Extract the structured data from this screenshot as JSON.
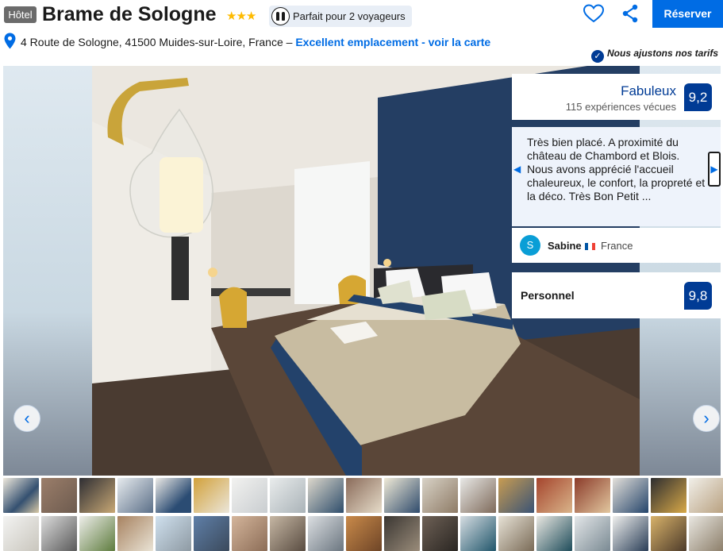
{
  "header": {
    "badge": "Hôtel",
    "hotel_name": "Brame de Sologne",
    "stars": "★★★",
    "travelers": "Parfait pour 2 voyageurs",
    "reserve_label": "Réserver",
    "address": "4 Route de Sologne, 41500 Muides-sur-Loire, France –",
    "location_link": "Excellent emplacement - voir la carte",
    "price_note": "Nous ajustons nos tarifs"
  },
  "icons": {
    "heart": "heart-icon",
    "share": "share-icon",
    "pin": "map-pin-icon",
    "check": "verified-check-icon",
    "travelers": "two-people-icon"
  },
  "gallery": {
    "prev": "‹",
    "next": "›"
  },
  "rating": {
    "label": "Fabuleux",
    "count": "115 expériences vécues",
    "score": "9,2"
  },
  "review": {
    "text": "Très bien placé. A proximité du château de Chambord et Blois. Nous avons apprécié l'accueil chaleureux, le confort, la propreté et la déco. Très Bon Petit ...",
    "prev": "◀",
    "next": "▶",
    "reviewer_initial": "S",
    "reviewer_name": "Sabine",
    "reviewer_country": "France"
  },
  "staff": {
    "label": "Personnel",
    "score": "9,8"
  },
  "colors": {
    "brand": "#006ce4",
    "navy": "#003b95",
    "star": "#febb02"
  }
}
